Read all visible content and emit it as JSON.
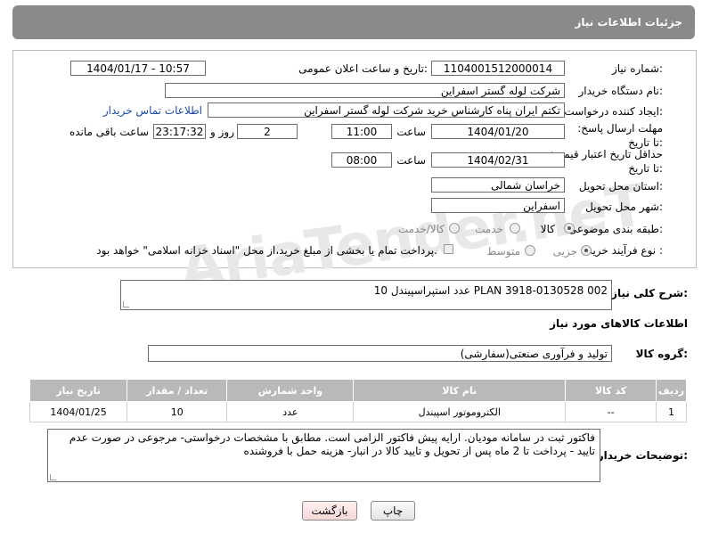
{
  "header": {
    "title": "جزئیات اطلاعات نیاز"
  },
  "fields": {
    "need_number_label": "شماره نیاز:",
    "need_number": "1104001512000014",
    "announce_label": "تاریخ و ساعت اعلان عمومی:",
    "announce_value": "1404/01/17 - 10:57",
    "buyer_org_label": "نام دستگاه خریدار:",
    "buyer_org": "شرکت لوله گستر اسفراین",
    "requester_label": "ایجاد کننده درخواست:",
    "requester": "تکتم ایران پناه کارشناس خرید شرکت لوله گستر اسفراین",
    "contact_link": "اطلاعات تماس خریدار",
    "deadline_label": "مهلت ارسال پاسخ: تا تاریخ:",
    "deadline_date": "1404/01/20",
    "time_label": "ساعت",
    "deadline_time": "11:00",
    "days_value": "2",
    "days_label": "روز و",
    "remaining_value": "23:17:32",
    "remaining_label": "ساعت باقی مانده",
    "validity_label": "حداقل تاریخ اعتبار قیمت: تا تاریخ:",
    "validity_date": "1404/02/31",
    "validity_time": "08:00",
    "province_label": "استان محل تحویل:",
    "province": "خراسان شمالی",
    "city_label": "شهر محل تحویل:",
    "city": "اسفراین",
    "category_label": "طبقه بندی موضوعی:",
    "cat_goods": "کالا",
    "cat_service": "خدمت",
    "cat_goods_service": "کالا/خدمت",
    "purchase_type_label": "نوع فرآیند خرید :",
    "pt_partial": "جزیی",
    "pt_medium": "متوسط",
    "pt_note": "پرداخت تمام یا بخشی از مبلغ خرید،از محل \"اسناد خزانه اسلامی\" خواهد بود."
  },
  "description": {
    "label": "شرح کلی نیاز:",
    "value": "10 عدد استپراسپیندل PLAN 3918-0130528 002"
  },
  "goods": {
    "section_title": "اطلاعات کالاهای مورد نیاز",
    "group_label": "گروه کالا:",
    "group_value": "تولید و فرآوری صنعتی(سفارشی)"
  },
  "table": {
    "headers": [
      "ردیف",
      "کد کالا",
      "نام کالا",
      "واحد شمارش",
      "تعداد / مقدار",
      "تاریخ نیاز"
    ],
    "rows": [
      {
        "row": "1",
        "code": "--",
        "name": "الکتروموتور اسپیندل",
        "unit": "عدد",
        "qty": "10",
        "date": "1404/01/25"
      }
    ]
  },
  "buyer_notes": {
    "label": "توضیحات خریدار:",
    "value": "فاکتور ثبت در سامانه مودیان. ارایه پیش فاکتور الزامی است. مطابق با مشخصات درخواستی- مرجوعی در صورت عدم تایید - پرداخت تا 2 ماه پس از تحویل و تایید کالا در انبار- هزینه حمل با فروشنده"
  },
  "buttons": {
    "print": "چاپ",
    "back": "بازگشت"
  }
}
